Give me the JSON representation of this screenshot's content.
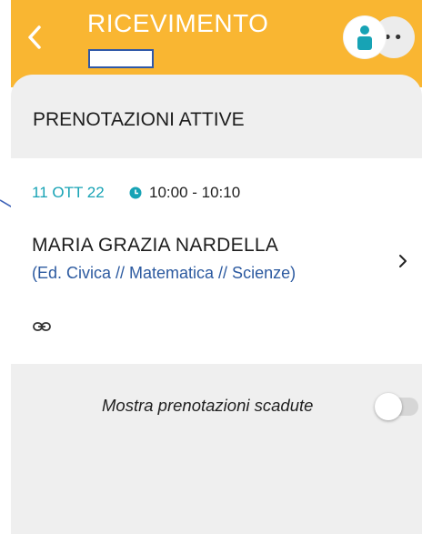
{
  "header": {
    "title": "RICEVIMENTO",
    "back_icon": "chevron-left-icon",
    "avatar_icon": "user-icon",
    "more_label": "••"
  },
  "section": {
    "title": "PRENOTAZIONI ATTIVE"
  },
  "appointment": {
    "date": "11 OTT 22",
    "time": "10:00 - 10:10",
    "teacher": "MARIA GRAZIA NARDELLA",
    "subjects": "(Ed. Civica // Matematica // Scienze)",
    "clock_icon": "clock-icon",
    "link_icon": "link-icon",
    "chevron_icon": "chevron-right-icon"
  },
  "toggle": {
    "label": "Mostra prenotazioni scadute",
    "value": false
  },
  "colors": {
    "header": "#f9b632",
    "accent_teal": "#17a3b5",
    "subject_blue": "#2c5aa0",
    "background": "#efefef"
  }
}
